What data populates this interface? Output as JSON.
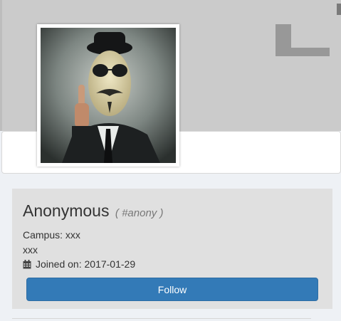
{
  "profile": {
    "name": "Anonymous",
    "handle": "( #anony )",
    "campus": "Campus: xxx",
    "extra": "xxx",
    "joined": "Joined on: 2017-01-29",
    "follow_label": "Follow"
  },
  "icons": {
    "calendar": "calendar-icon"
  },
  "colors": {
    "cover": "#cbcbcb",
    "follow_button": "#337ab7",
    "card": "#e0e0e0",
    "page": "#eef1f5"
  }
}
